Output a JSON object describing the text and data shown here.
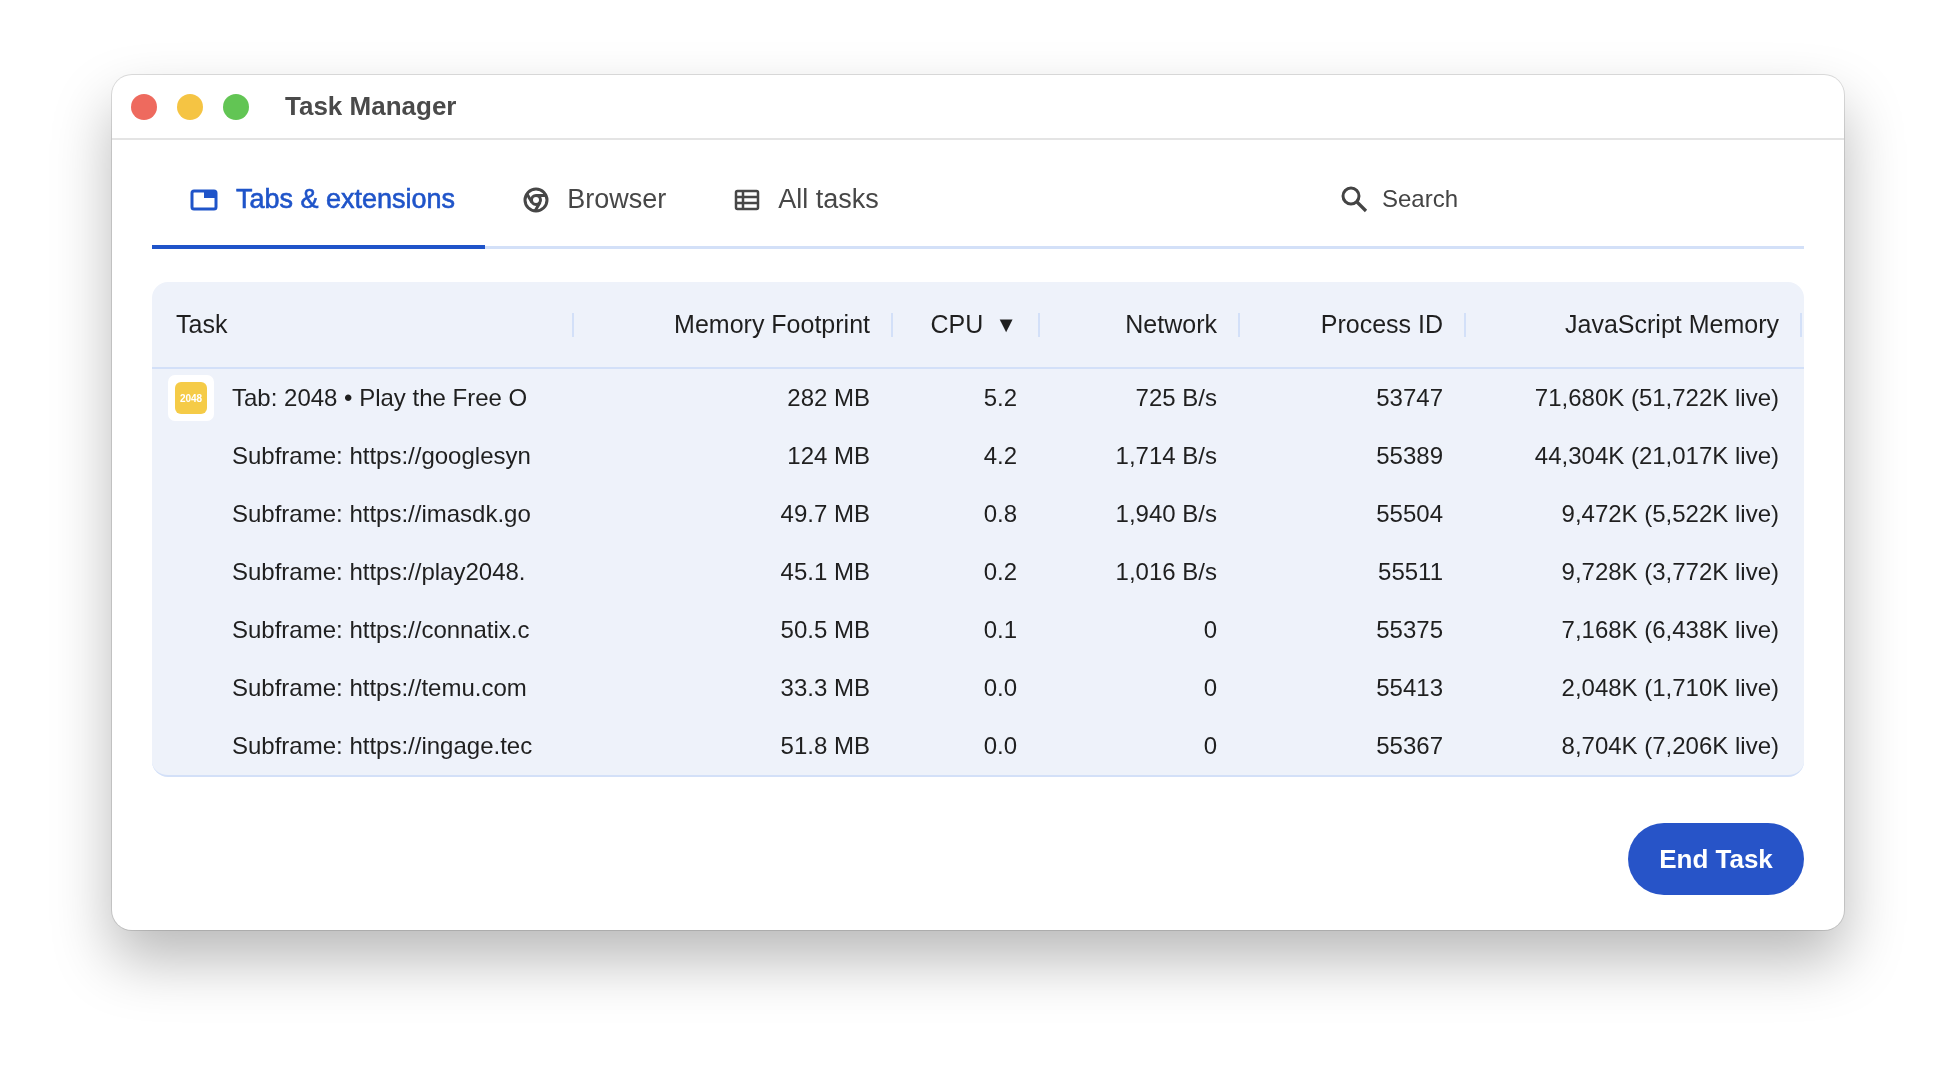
{
  "window": {
    "title": "Task Manager"
  },
  "tabs": [
    {
      "label": "Tabs & extensions",
      "selected": true
    },
    {
      "label": "Browser",
      "selected": false
    },
    {
      "label": "All tasks",
      "selected": false
    }
  ],
  "search": {
    "placeholder": "Search"
  },
  "table": {
    "columns": [
      {
        "label": "Task"
      },
      {
        "label": "Memory Footprint"
      },
      {
        "label": "CPU",
        "sort_indicator": "▼"
      },
      {
        "label": "Network"
      },
      {
        "label": "Process ID"
      },
      {
        "label": "JavaScript Memory"
      }
    ],
    "rows": [
      {
        "favicon": "2048",
        "cells": [
          "Tab: 2048 • Play the Free O",
          "282 MB",
          "5.2",
          "725 B/s",
          "53747",
          "71,680K (51,722K live)"
        ]
      },
      {
        "cells": [
          "Subframe: https://googlesyn",
          "124 MB",
          "4.2",
          "1,714 B/s",
          "55389",
          "44,304K (21,017K live)"
        ]
      },
      {
        "cells": [
          "Subframe: https://imasdk.go",
          "49.7 MB",
          "0.8",
          "1,940 B/s",
          "55504",
          "9,472K (5,522K live)"
        ]
      },
      {
        "cells": [
          "Subframe: https://play2048.",
          "45.1 MB",
          "0.2",
          "1,016 B/s",
          "55511",
          "9,728K (3,772K live)"
        ]
      },
      {
        "cells": [
          "Subframe: https://connatix.c",
          "50.5 MB",
          "0.1",
          "0",
          "55375",
          "7,168K (6,438K live)"
        ]
      },
      {
        "cells": [
          "Subframe: https://temu.com",
          "33.3 MB",
          "0.0",
          "0",
          "55413",
          "2,048K (1,710K live)"
        ]
      },
      {
        "cells": [
          "Subframe: https://ingage.tec",
          "51.8 MB",
          "0.0",
          "0",
          "55367",
          "8,704K (7,206K live)"
        ]
      }
    ]
  },
  "end_button": "End Task"
}
